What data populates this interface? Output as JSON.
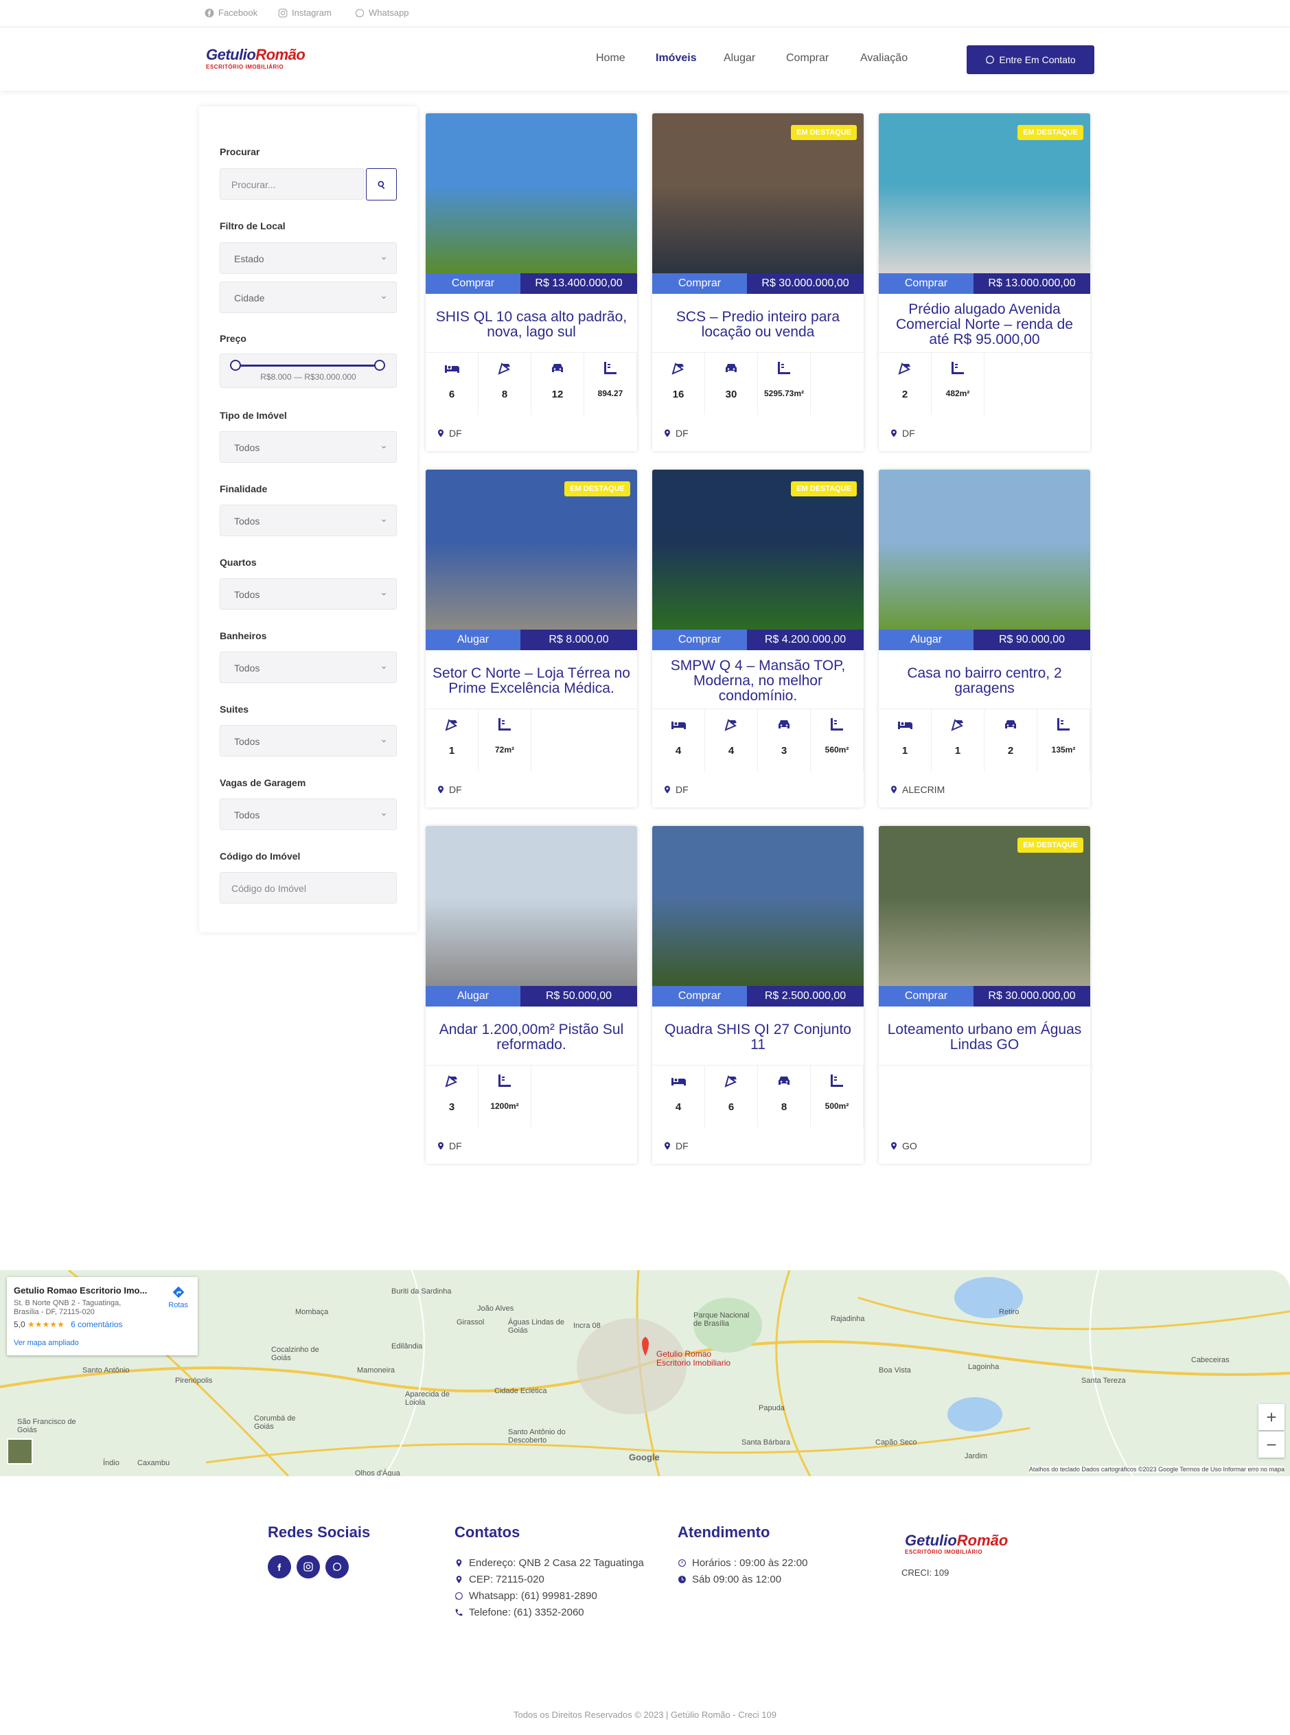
{
  "topbar": {
    "facebook": "Facebook",
    "instagram": "Instagram",
    "whatsapp": "Whatsapp"
  },
  "header": {
    "logo_top": "Getulio",
    "logo_top2": "Romão",
    "logo_bottom": "ESCRITÓRIO IMOBILIÁRIO",
    "nav": [
      "Home",
      "Imóveis",
      "Alugar",
      "Comprar",
      "Avaliação"
    ],
    "active_nav": "Imóveis",
    "cta_label": "Entre Em Contato"
  },
  "sidebar": {
    "search_label": "Procurar",
    "search_placeholder": "Procurar...",
    "local_label": "Filtro de Local",
    "estado": "Estado",
    "cidade": "Cidade",
    "price_label": "Preço",
    "price_range": "R$8.000 — R$30.000.000",
    "tipo_label": "Tipo de Imóvel",
    "finalidade_label": "Finalidade",
    "quartos_label": "Quartos",
    "banheiros_label": "Banheiros",
    "suites_label": "Suites",
    "vagas_label": "Vagas de Garagem",
    "all_option": "Todos",
    "codigo_label": "Código do Imóvel",
    "codigo_placeholder": "Código do Imóvel"
  },
  "listings": [
    {
      "badge": "",
      "tag": "Comprar",
      "price": "R$ 13.400.000,00",
      "title": "SHIS QL 10 casa alto padrão, nova, lago sul",
      "features": [
        {
          "icon": "bed-icon",
          "value": "6"
        },
        {
          "icon": "bath-icon",
          "value": "8"
        },
        {
          "icon": "car-icon",
          "value": "12"
        },
        {
          "icon": "area-icon",
          "value": "894.27"
        }
      ],
      "location": "DF"
    },
    {
      "badge": "EM DESTAQUE",
      "tag": "Comprar",
      "price": "R$ 30.000.000,00",
      "title": "SCS – Predio inteiro para locação ou venda",
      "features": [
        {
          "icon": "bath-icon",
          "value": "16"
        },
        {
          "icon": "car-icon",
          "value": "30"
        },
        {
          "icon": "area-icon",
          "value": "5295.73m²"
        }
      ],
      "location": "DF"
    },
    {
      "badge": "EM DESTAQUE",
      "tag": "Comprar",
      "price": "R$ 13.000.000,00",
      "title": "Prédio alugado Avenida Comercial Norte – renda de até R$ 95.000,00",
      "features": [
        {
          "icon": "bath-icon",
          "value": "2"
        },
        {
          "icon": "area-icon",
          "value": "482m²"
        }
      ],
      "location": "DF"
    },
    {
      "badge": "EM DESTAQUE",
      "tag": "Alugar",
      "price": "R$ 8.000,00",
      "title": "Setor C Norte – Loja Térrea no Prime Excelência Médica.",
      "features": [
        {
          "icon": "bath-icon",
          "value": "1"
        },
        {
          "icon": "area-icon",
          "value": "72m²"
        }
      ],
      "location": "DF"
    },
    {
      "badge": "EM DESTAQUE",
      "tag": "Comprar",
      "price": "R$ 4.200.000,00",
      "title": "SMPW Q 4 – Mansão TOP, Moderna, no melhor condomínio.",
      "features": [
        {
          "icon": "bed-icon",
          "value": "4"
        },
        {
          "icon": "bath-icon",
          "value": "4"
        },
        {
          "icon": "car-icon",
          "value": "3"
        },
        {
          "icon": "area-icon",
          "value": "560m²"
        }
      ],
      "location": "DF"
    },
    {
      "badge": "",
      "tag": "Alugar",
      "price": "R$ 90.000,00",
      "title": "Casa no bairro centro, 2 garagens",
      "features": [
        {
          "icon": "bed-icon",
          "value": "1"
        },
        {
          "icon": "bath-icon",
          "value": "1"
        },
        {
          "icon": "car-icon",
          "value": "2"
        },
        {
          "icon": "area-icon",
          "value": "135m²"
        }
      ],
      "location": "ALECRIM"
    },
    {
      "badge": "",
      "tag": "Alugar",
      "price": "R$ 50.000,00",
      "title": "Andar 1.200,00m² Pistão Sul reformado.",
      "features": [
        {
          "icon": "bath-icon",
          "value": "3"
        },
        {
          "icon": "area-icon",
          "value": "1200m²"
        }
      ],
      "location": "DF"
    },
    {
      "badge": "",
      "tag": "Comprar",
      "price": "R$ 2.500.000,00",
      "title": "Quadra SHIS QI 27 Conjunto 11",
      "features": [
        {
          "icon": "bed-icon",
          "value": "4"
        },
        {
          "icon": "bath-icon",
          "value": "6"
        },
        {
          "icon": "car-icon",
          "value": "8"
        },
        {
          "icon": "area-icon",
          "value": "500m²"
        }
      ],
      "location": "DF"
    },
    {
      "badge": "EM DESTAQUE",
      "tag": "Comprar",
      "price": "R$ 30.000.000,00",
      "title": "Loteamento urbano em Águas Lindas GO",
      "features": [],
      "location": "GO"
    }
  ],
  "map": {
    "place_name": "Getulio Romao Escritorio Imo...",
    "address1": "St. B Norte QNB 2 - Taguatinga,",
    "address2": "Brasília - DF, 72115-020",
    "rating": "5,0",
    "stars": "★★★★★",
    "reviews": "6 comentários",
    "directions": "Rotas",
    "view_larger": "Ver mapa ampliado",
    "pin_label1": "Getulio Romao",
    "pin_label2": "Escritorio Imobiliario",
    "attribution": "Atalhos do teclado   Dados cartográficos ©2023 Google   Termos de Uso   Informar erro no mapa",
    "google": "Google",
    "cities": [
      {
        "name": "Mombaça"
      },
      {
        "name": "Buriti da Sardinha"
      },
      {
        "name": "João Alves"
      },
      {
        "name": "Girassol"
      },
      {
        "name": "Águas Lindas de Goiás"
      },
      {
        "name": "Incra 08"
      },
      {
        "name": "Parque Nacional de Brasília"
      },
      {
        "name": "Rajadinha"
      },
      {
        "name": "Retiro"
      },
      {
        "name": "Cocalzinho de Goiás"
      },
      {
        "name": "Edilândia"
      },
      {
        "name": "Mamoneira"
      },
      {
        "name": "Santo Antônio"
      },
      {
        "name": "Pirenópolis"
      },
      {
        "name": "Aparecida de Loiola"
      },
      {
        "name": "Cidade Eclética"
      },
      {
        "name": "Boa Vista"
      },
      {
        "name": "Lagoinha"
      },
      {
        "name": "Cabeceiras"
      },
      {
        "name": "Santa Tereza"
      },
      {
        "name": "São Francisco de Goiás"
      },
      {
        "name": "Corumbá de Goiás"
      },
      {
        "name": "Papuda"
      },
      {
        "name": "Santo Antônio do Descoberto"
      },
      {
        "name": "Santa Bárbara"
      },
      {
        "name": "Capão Seco"
      },
      {
        "name": "Jardim"
      },
      {
        "name": "Índio"
      },
      {
        "name": "Caxambu"
      },
      {
        "name": "Olhos d'Água"
      }
    ]
  },
  "footer": {
    "social_title": "Redes Sociais",
    "contacts_title": "Contatos",
    "address": "Endereço: QNB 2 Casa 22 Taguatinga",
    "cep": "CEP: 72115-020",
    "whatsapp": "Whatsapp: (61) 99981-2890",
    "phone": "Telefone: (61) 3352-2060",
    "hours_title": "Atendimento",
    "hours1": "Horários : 09:00 às 22:00",
    "hours2": "Sáb 09:00 às 12:00",
    "creci": "CRECI: 109",
    "copyright": "Todos os Direitos Reservados © 2023 | Getúlio Romão - Creci 109"
  },
  "colors": {
    "primary": "#2c2a8c",
    "accent": "#4a73d9",
    "badge": "#f7e51d",
    "brand_red": "#d31d1d"
  }
}
